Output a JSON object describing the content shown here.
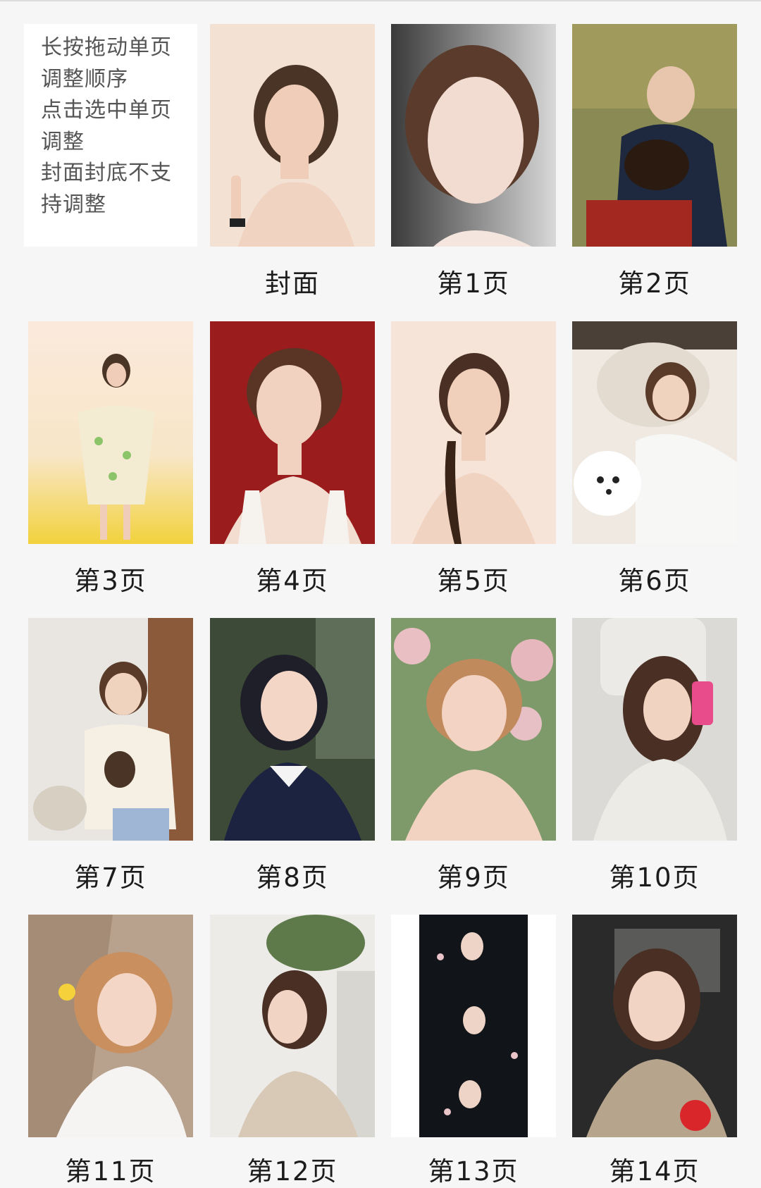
{
  "instructions": {
    "lines": [
      "长按拖动单页",
      "调整顺序",
      "点击选中单页",
      "调整",
      "封面封底不支",
      "持调整"
    ]
  },
  "pages": [
    {
      "label": "封面"
    },
    {
      "label": "第1页"
    },
    {
      "label": "第2页"
    },
    {
      "label": "第3页"
    },
    {
      "label": "第4页"
    },
    {
      "label": "第5页"
    },
    {
      "label": "第6页"
    },
    {
      "label": "第7页"
    },
    {
      "label": "第8页"
    },
    {
      "label": "第9页"
    },
    {
      "label": "第10页"
    },
    {
      "label": "第11页"
    },
    {
      "label": "第12页"
    },
    {
      "label": "第13页"
    },
    {
      "label": "第14页"
    }
  ]
}
